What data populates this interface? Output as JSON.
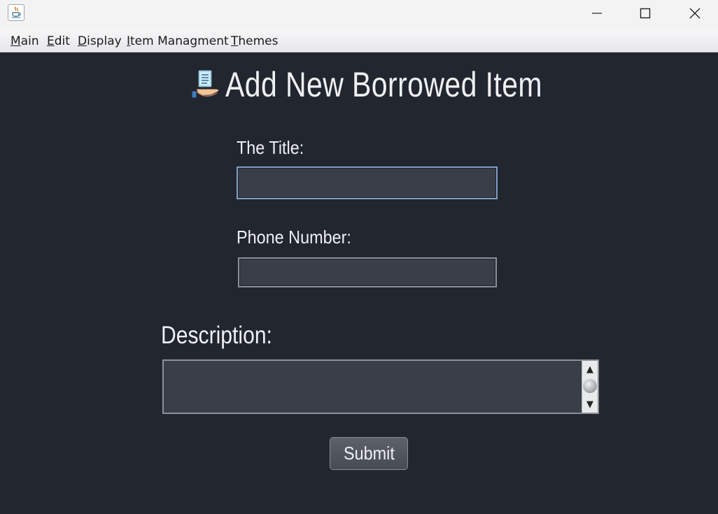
{
  "window": {
    "title": "",
    "app_icon": "java-cup-icon",
    "controls": [
      "minimize-icon",
      "maximize-icon",
      "close-icon"
    ]
  },
  "menubar": {
    "items": [
      {
        "mnemonic": "M",
        "rest": "ain"
      },
      {
        "mnemonic": "E",
        "rest": "dit"
      },
      {
        "mnemonic": "D",
        "rest": "isplay"
      },
      {
        "mnemonic": "I",
        "rest": "tem Managment"
      },
      {
        "mnemonic": "T",
        "rest": "hemes"
      }
    ]
  },
  "form": {
    "heading": "Add New Borrowed Item",
    "heading_icon": "hand-holding-book-icon",
    "title_label": "The Title:",
    "title_value": "",
    "phone_label": "Phone Number:",
    "phone_value": "",
    "description_label": "Description:",
    "description_value": "",
    "submit_label": "Submit"
  },
  "colors": {
    "background": "#22262f",
    "field_background": "#3a3e48",
    "focus_border": "#7f9fc4",
    "text": "#eef0f3"
  }
}
